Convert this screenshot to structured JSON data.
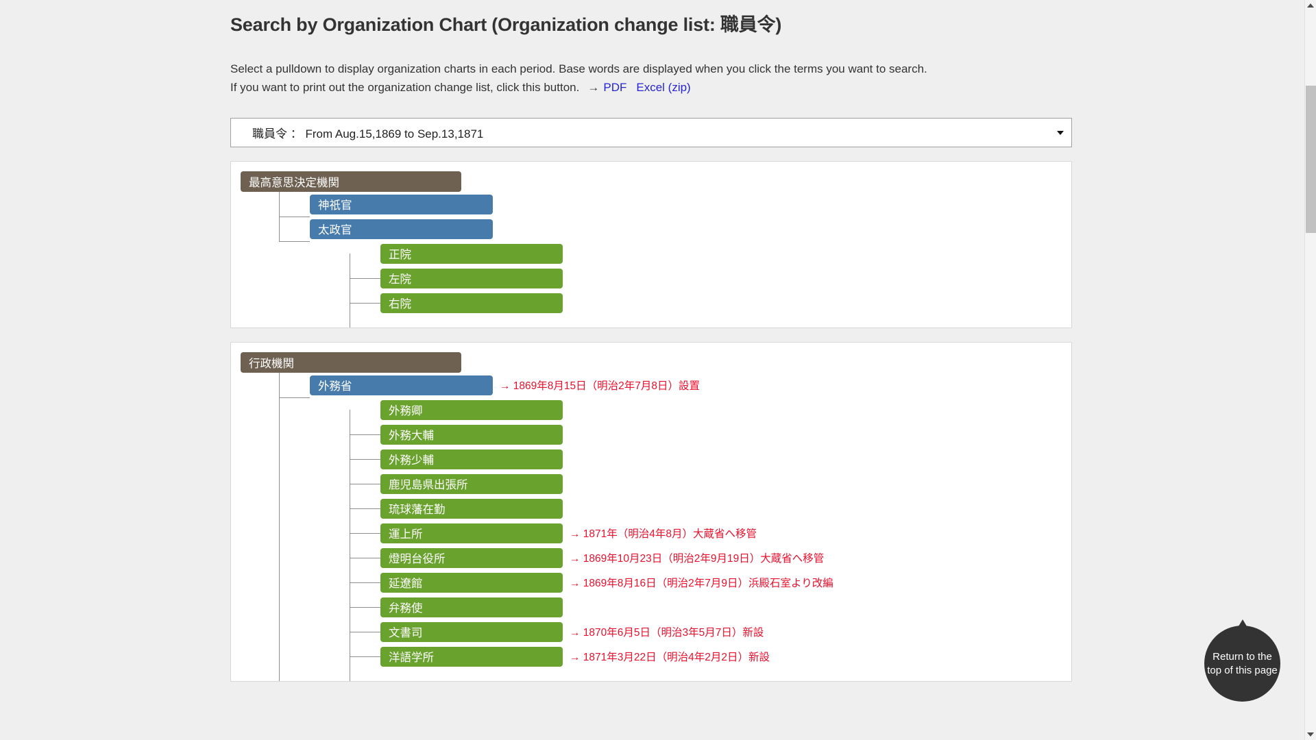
{
  "page": {
    "title": "Search by Organization Chart (Organization change list: 職員令)",
    "intro_line1": "Select a pulldown to display organization charts in each period. Base words are displayed when you click the terms you want to search.",
    "intro_line2": "If you want to print out the organization change list, click this button.",
    "arrow": "→",
    "pdf_label": "PDF",
    "excel_label": "Excel (zip)"
  },
  "pulldown": {
    "value": "職員令 ： From Aug.15,1869 to Sep.13,1871",
    "caret": "chevron-down-icon"
  },
  "return_top": {
    "label": "Return to the top of this page"
  },
  "colors": {
    "root": "#6e6151",
    "level1": "#477bab",
    "level2": "#6aa22e",
    "note": "#e8112d",
    "link": "#2424d6",
    "page_bg": "#efefef"
  },
  "chart_data": {
    "type": "table",
    "title": "Organization chart: 職員令 (From Aug.15,1869 to Sep.13,1871)",
    "panels": [
      {
        "root": "最高意思決定機関",
        "children": [
          {
            "label": "神祇官",
            "note": "",
            "children": []
          },
          {
            "label": "太政官",
            "note": "",
            "children": [
              {
                "label": "正院",
                "note": ""
              },
              {
                "label": "左院",
                "note": ""
              },
              {
                "label": "右院",
                "note": ""
              }
            ]
          }
        ]
      },
      {
        "root": "行政機関",
        "children": [
          {
            "label": "外務省",
            "note": "→ 1869年8月15日（明治2年7月8日）設置",
            "children": [
              {
                "label": "外務卿",
                "note": ""
              },
              {
                "label": "外務大輔",
                "note": ""
              },
              {
                "label": "外務少輔",
                "note": ""
              },
              {
                "label": "鹿児島県出張所",
                "note": ""
              },
              {
                "label": "琉球藩在勤",
                "note": ""
              },
              {
                "label": "運上所",
                "note": "→ 1871年（明治4年8月）大蔵省へ移管"
              },
              {
                "label": "燈明台役所",
                "note": "→ 1869年10月23日（明治2年9月19日）大蔵省へ移管"
              },
              {
                "label": "延遼館",
                "note": "→ 1869年8月16日（明治2年7月9日）浜殿石室より改編"
              },
              {
                "label": "弁務使",
                "note": ""
              },
              {
                "label": "文書司",
                "note": "→ 1870年6月5日（明治3年5月7日）新設"
              },
              {
                "label": "洋語学所",
                "note": "→ 1871年3月22日（明治4年2月2日）新設"
              }
            ]
          }
        ]
      }
    ]
  }
}
